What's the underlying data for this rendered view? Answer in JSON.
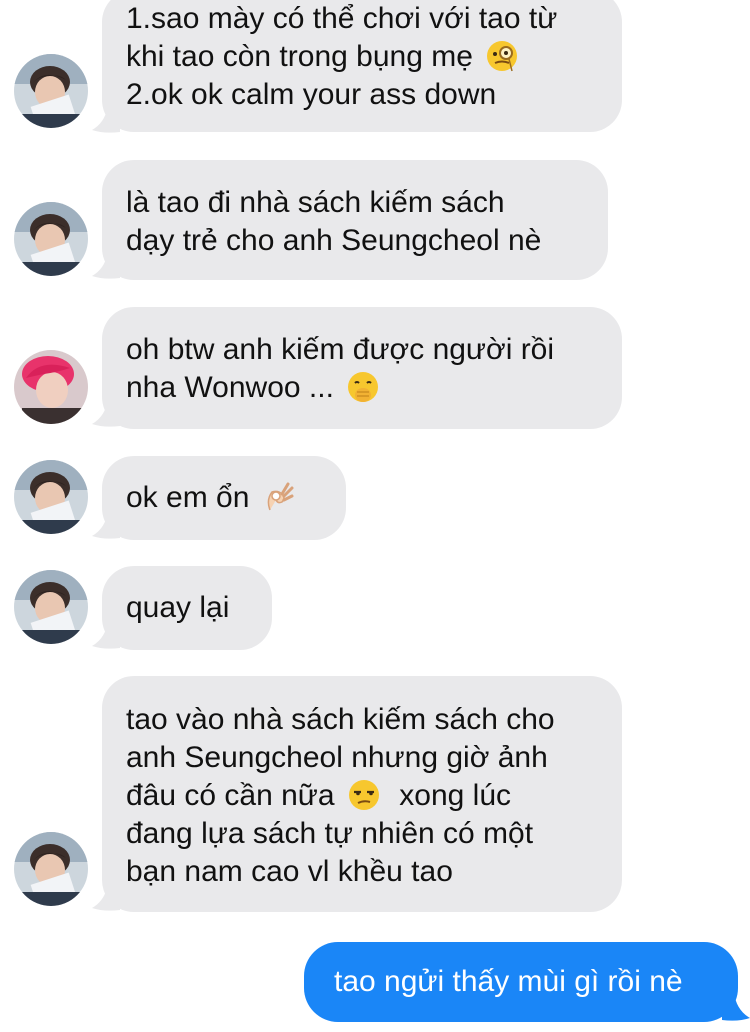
{
  "colors": {
    "incoming_bubble": "#e9e9eb",
    "outgoing_bubble": "#1a86f7",
    "incoming_text": "#111111",
    "outgoing_text": "#ffffff"
  },
  "messages": [
    {
      "sender": "incoming",
      "avatar": "avatar-boy-reading",
      "lines": [
        "1.sao mày có thể chơi với tao từ",
        "khi tao còn trong bụng mẹ",
        "2.ok ok calm your ass down"
      ],
      "emoji": "monocle-face-emoji"
    },
    {
      "sender": "incoming",
      "avatar": "avatar-boy-reading",
      "lines": [
        "là tao đi nhà sách kiếm sách",
        "dạy trẻ cho anh Seungcheol nè"
      ]
    },
    {
      "sender": "incoming",
      "avatar": "avatar-pink-hair",
      "lines": [
        "oh btw anh kiếm được người rồi",
        "nha Wonwoo ..."
      ],
      "emoji": "hand-over-mouth-emoji"
    },
    {
      "sender": "incoming",
      "avatar": "avatar-boy-reading",
      "lines": [
        "ok em ổn"
      ],
      "emoji": "ok-hand-emoji"
    },
    {
      "sender": "incoming",
      "avatar": "avatar-boy-reading",
      "lines": [
        "quay lại"
      ]
    },
    {
      "sender": "incoming",
      "avatar": "avatar-boy-reading",
      "lines": [
        "tao vào nhà sách kiếm sách cho",
        "anh Seungcheol nhưng giờ ảnh",
        "đâu có cần nữa",
        "đang lựa sách tự nhiên có một",
        "bạn nam cao vl khều tao"
      ],
      "line3_suffix": "xong lúc",
      "emoji": "unamused-face-emoji"
    },
    {
      "sender": "outgoing",
      "lines": [
        "tao ngửi thấy mùi gì rồi nè"
      ]
    }
  ]
}
